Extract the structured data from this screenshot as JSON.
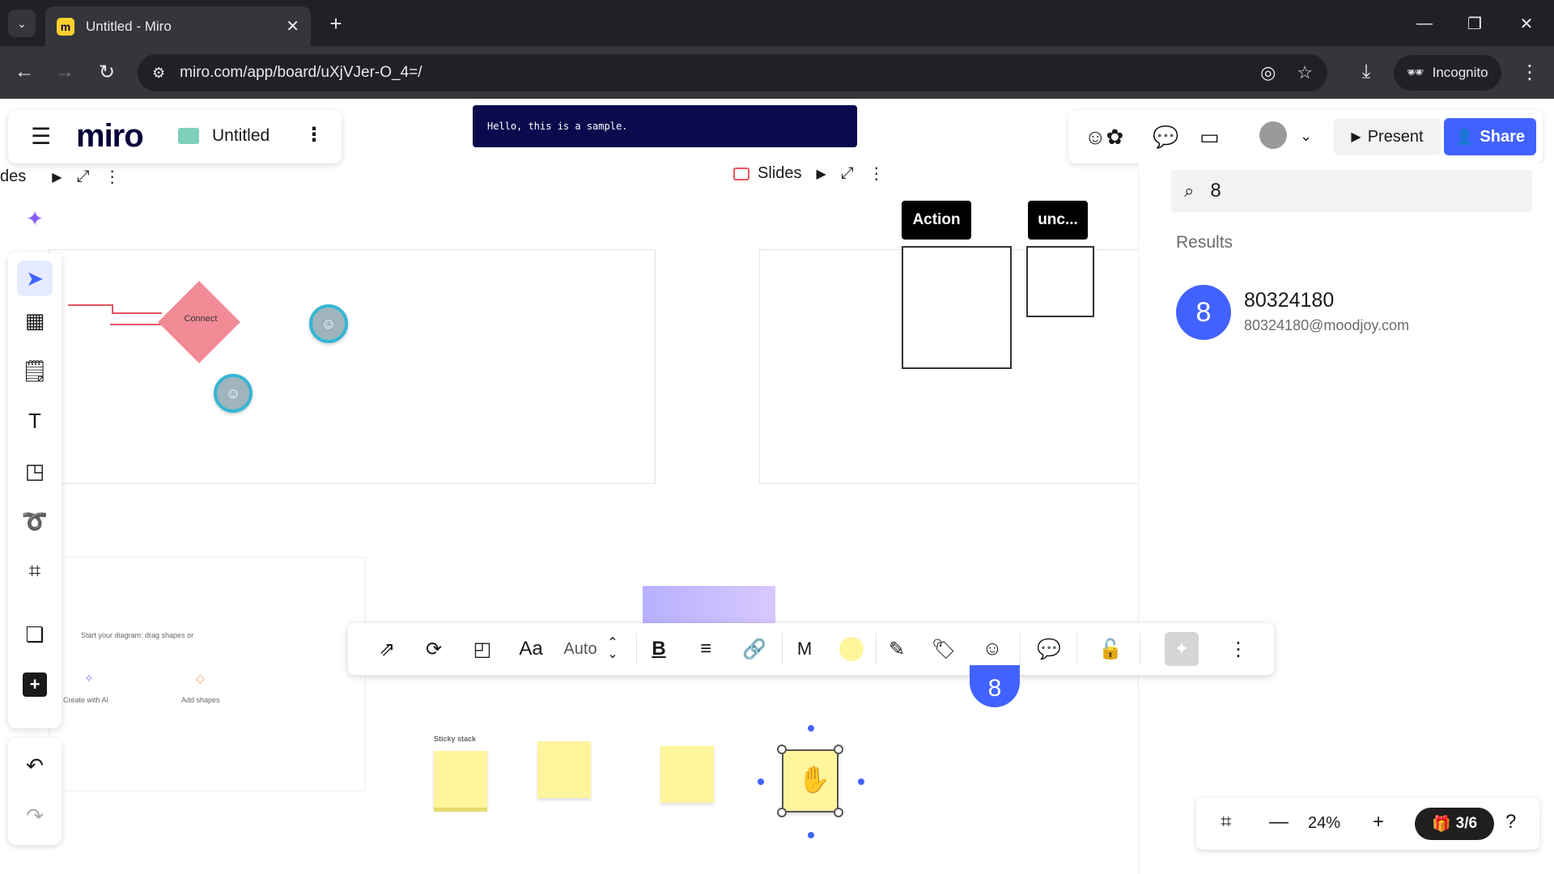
{
  "browser": {
    "tab_title": "Untitled - Miro",
    "tab_favicon": "m",
    "url": "miro.com/app/board/uXjVJer-O_4=/",
    "incognito_label": "Incognito"
  },
  "header": {
    "app_name": "miro",
    "board_name": "Untitled"
  },
  "banner": {
    "text": "Hello, this is a sample."
  },
  "slides": {
    "left_label": "des",
    "center_label": "Slides"
  },
  "canvas": {
    "diamond_label": "Connect",
    "tag_action": "Action",
    "tag_unc": "unc...",
    "diagram_hint": "Start your diagram: drag shapes or",
    "create_ai": "Create with AI",
    "add_shapes": "Add shapes",
    "sticky_stack": "Sticky stack",
    "cursor_number": "8"
  },
  "right_header": {
    "present_label": "Present",
    "share_label": "Share"
  },
  "search": {
    "query": "8",
    "results_label": "Results",
    "result": {
      "avatar_text": "8",
      "name": "80324180",
      "email": "80324180@moodjoy.com"
    }
  },
  "context_toolbar": {
    "font_size": "Auto",
    "font_initial": "M",
    "sticky_color": "#fff59d"
  },
  "zoom": {
    "level": "24%",
    "pages": "3/6"
  },
  "colors": {
    "accent": "#4262ff",
    "sticky": "#fff59d",
    "diamond": "#f28b96"
  }
}
